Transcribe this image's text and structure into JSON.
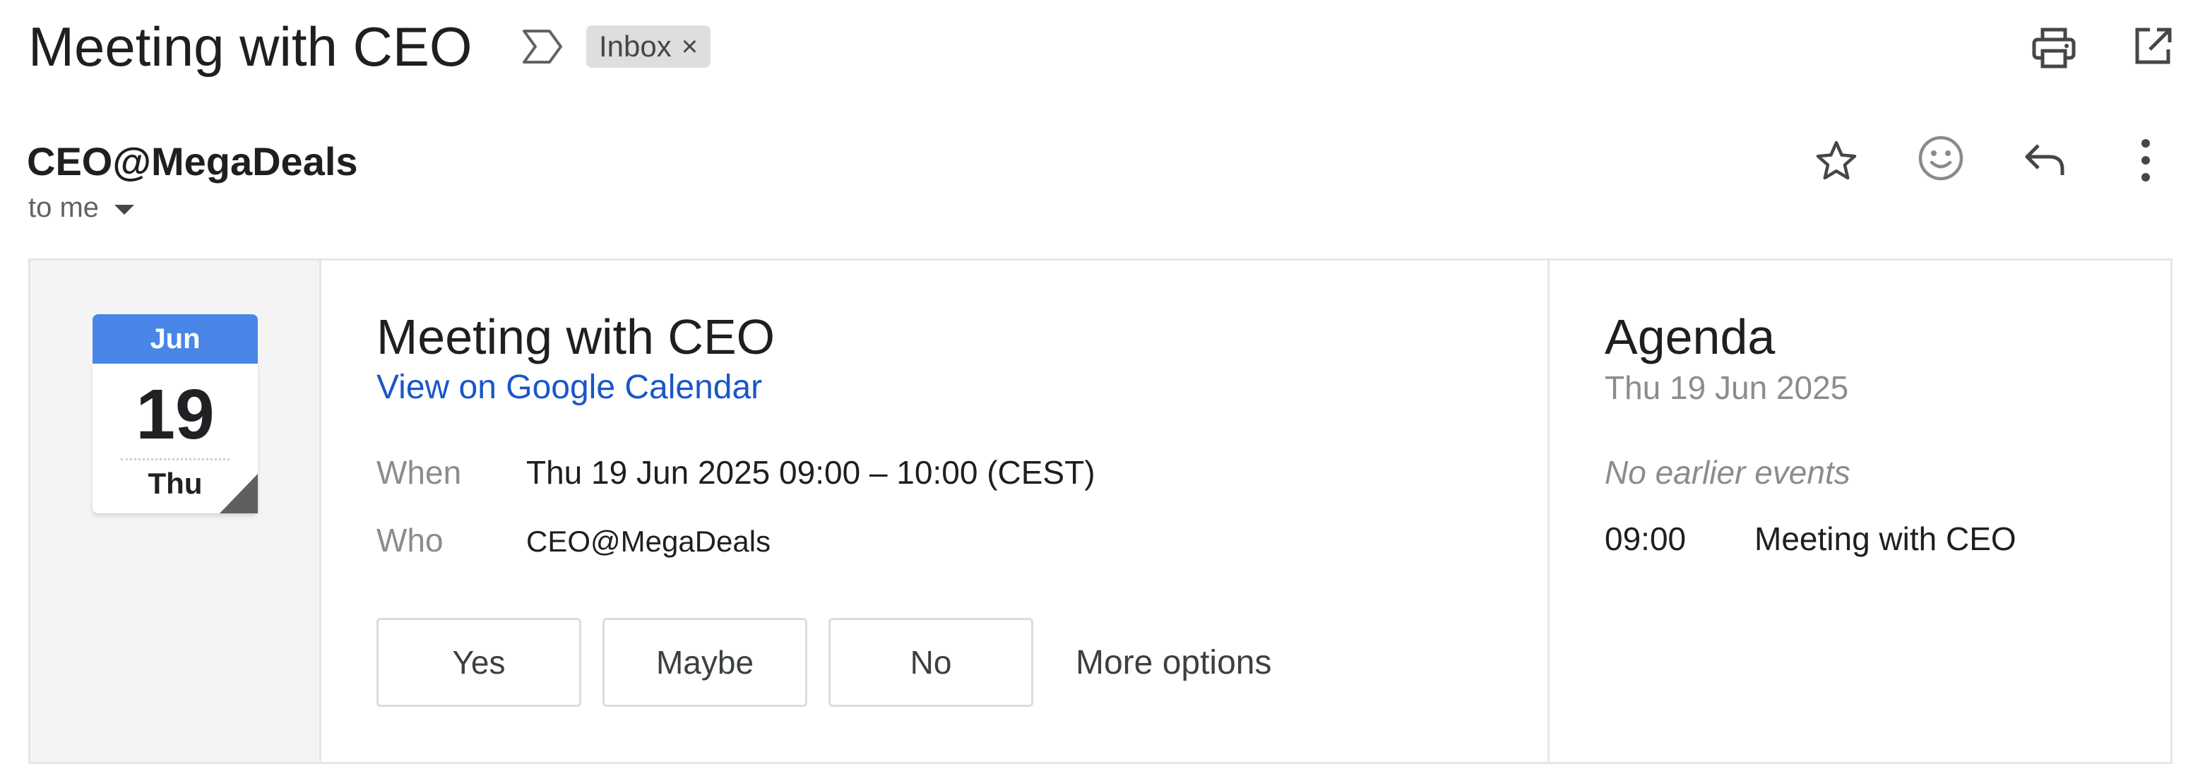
{
  "header": {
    "subject": "Meeting with CEO",
    "label_chip": "Inbox",
    "label_chip_close": "×"
  },
  "message": {
    "sender": "CEO@MegaDeals",
    "recipients": "to me"
  },
  "invite": {
    "calendar_icon": {
      "month": "Jun",
      "day": "19",
      "weekday": "Thu"
    },
    "title": "Meeting with CEO",
    "calendar_link": "View on Google Calendar",
    "when_label": "When",
    "when_value": "Thu 19 Jun 2025 09:00 – 10:00 (CEST)",
    "who_label": "Who",
    "who_value": "CEO@MegaDeals",
    "rsvp": {
      "yes": "Yes",
      "maybe": "Maybe",
      "no": "No",
      "more": "More options"
    }
  },
  "agenda": {
    "title": "Agenda",
    "date": "Thu 19 Jun 2025",
    "empty_text": "No earlier events",
    "events": [
      {
        "time": "09:00",
        "title": "Meeting with CEO"
      }
    ]
  },
  "icons": {
    "important_marker": "important-marker-icon",
    "print": "print-icon",
    "open_new_window": "open-in-new-window-icon",
    "star": "star-icon",
    "emoji": "emoji-reaction-icon",
    "reply": "reply-icon",
    "more": "more-vert-icon"
  },
  "colors": {
    "calendar_month_bg": "#4a86e8",
    "link": "#1a56c8",
    "label_chip_bg": "#dedede",
    "muted_text": "#8c8c8c"
  }
}
